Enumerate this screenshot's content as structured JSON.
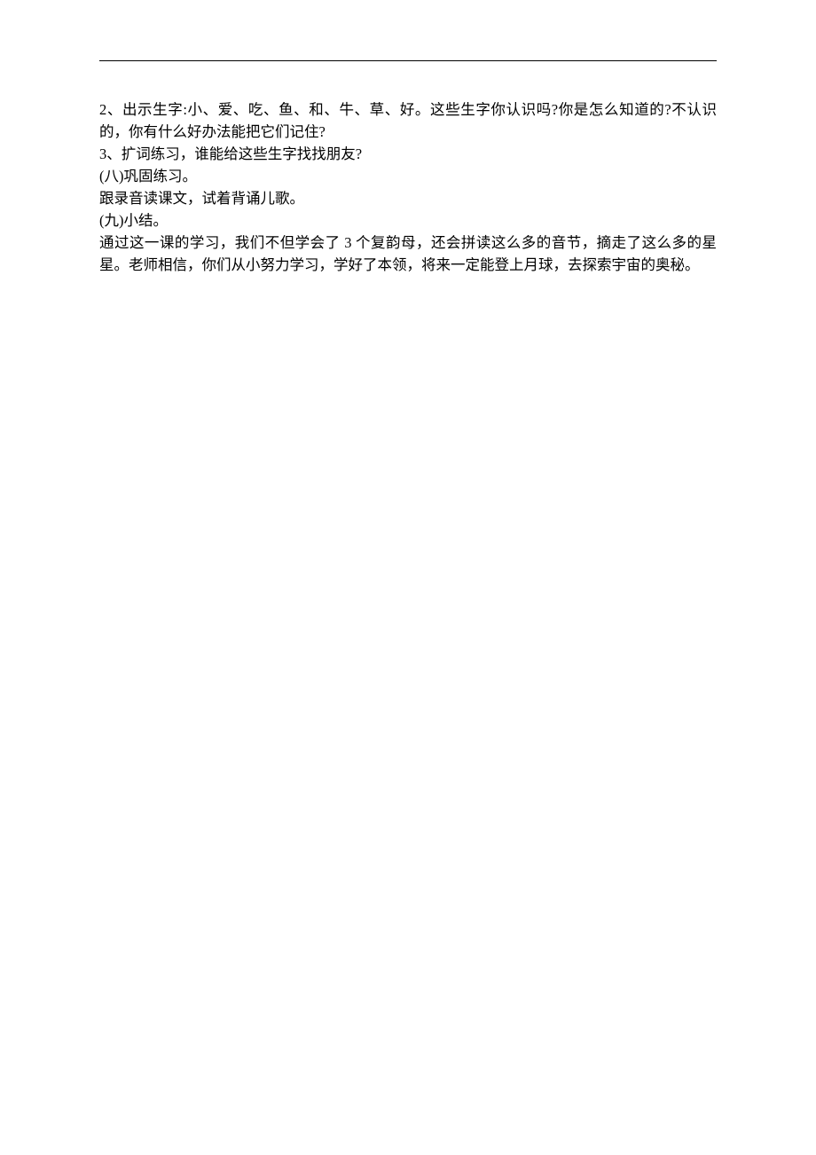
{
  "document": {
    "paragraphs": [
      "2、出示生字:小、爱、吃、鱼、和、牛、草、好。这些生字你认识吗?你是怎么知道的?不认识的，你有什么好办法能把它们记住?",
      "3、扩词练习，谁能给这些生字找找朋友?",
      "(八)巩固练习。",
      "跟录音读课文，试着背诵儿歌。",
      "(九)小结。",
      "通过这一课的学习，我们不但学会了 3 个复韵母，还会拼读这么多的音节，摘走了这么多的星星。老师相信，你们从小努力学习，学好了本领，将来一定能登上月球，去探索宇宙的奥秘。"
    ]
  }
}
